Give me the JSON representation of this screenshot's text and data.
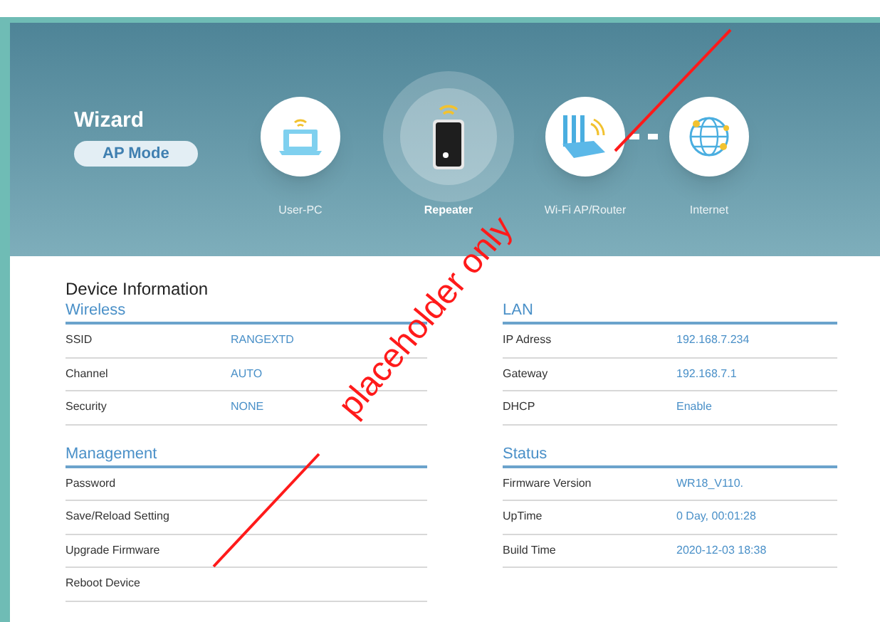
{
  "header": {
    "title": "Wizard",
    "mode": "AP Mode",
    "devices": [
      {
        "kind": "laptop",
        "label": "User-PC",
        "highlighted": false
      },
      {
        "kind": "repeater",
        "label": "Repeater",
        "highlighted": true
      },
      {
        "kind": "router",
        "label": "Wi-Fi AP/Router",
        "highlighted": false
      },
      {
        "kind": "globe",
        "label": "Internet",
        "highlighted": false
      }
    ]
  },
  "device_information": {
    "title": "Device Information",
    "sections": [
      {
        "title": "Wireless",
        "rows": [
          {
            "label": "SSID",
            "value": "RANGEXTD"
          },
          {
            "label": "Channel",
            "value": "AUTO"
          },
          {
            "label": "Security",
            "value": "NONE"
          }
        ]
      },
      {
        "title": "LAN",
        "rows": [
          {
            "label": "IP Adress",
            "value": "192.168.7.234"
          },
          {
            "label": "Gateway",
            "value": "192.168.7.1"
          },
          {
            "label": "DHCP",
            "value": "Enable"
          }
        ]
      },
      {
        "title": "Management",
        "rows": [
          {
            "label": "Password"
          },
          {
            "label": "Save/Reload Setting"
          },
          {
            "label": "Upgrade Firmware"
          },
          {
            "label": "Reboot Device"
          }
        ]
      },
      {
        "title": "Status",
        "rows": [
          {
            "label": "Firmware Version",
            "value": "WR18_V110."
          },
          {
            "label": "UpTime",
            "value": "0 Day, 00:01:28"
          },
          {
            "label": "Build Time",
            "value": "2020-12-03 18:38"
          }
        ]
      }
    ]
  },
  "annotation": {
    "text": "placeholder only"
  }
}
